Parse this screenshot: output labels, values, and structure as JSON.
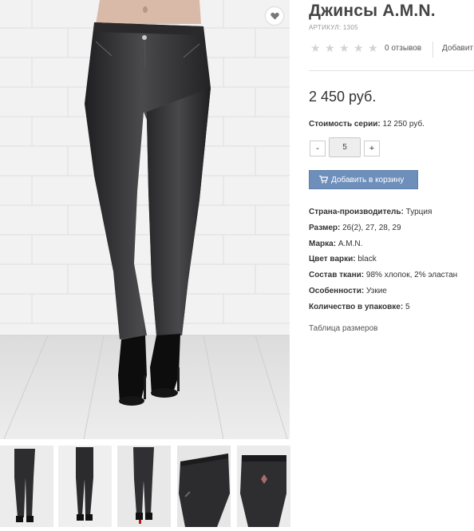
{
  "product": {
    "title": "Джинсы A.M.N.",
    "article": "АРТИКУЛ: 1305",
    "reviews": "0 отзывов",
    "add_review": "Добавит",
    "price": "2 450 руб.",
    "series_label": "Стоимость серии:",
    "series_value": "12 250 руб.",
    "quantity": "5",
    "minus": "-",
    "plus": "+",
    "cart_button": "Добавить в корзину",
    "sizes_link": "Таблица размеров",
    "rating": {
      "value": 0,
      "max": 5
    }
  },
  "properties": [
    {
      "label": "Страна-производитель:",
      "value": "Турция"
    },
    {
      "label": "Размер:",
      "value": "26(2), 27, 28, 29"
    },
    {
      "label": "Марка:",
      "value": "A.M.N."
    },
    {
      "label": "Цвет варки:",
      "value": "black"
    },
    {
      "label": "Состав ткани:",
      "value": "98% хлопок, 2% эластан"
    },
    {
      "label": "Особенности:",
      "value": "Узкие"
    },
    {
      "label": "Количество в упаковке:",
      "value": "5"
    }
  ],
  "icons": {
    "favorite": "heart-icon",
    "star": "star-icon",
    "cart": "cart-icon"
  },
  "colors": {
    "button": "#6f8fbb",
    "star_empty": "#d3d3d3",
    "denim": "#2f2f31"
  }
}
